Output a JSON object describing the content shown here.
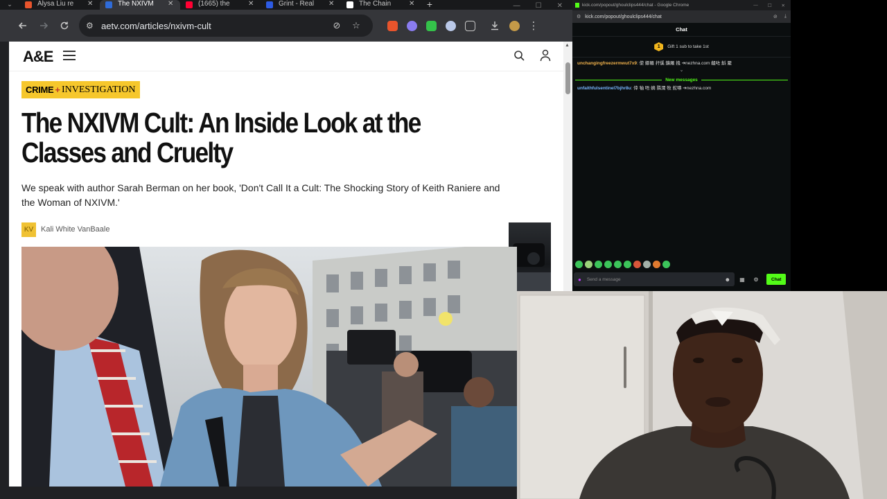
{
  "browser": {
    "tabs": [
      {
        "title": "Alysa Liu re",
        "favicon_color": "#e8542c",
        "active": false
      },
      {
        "title": "The NXIVM",
        "favicon_color": "#2f6bd8",
        "active": true
      },
      {
        "title": "(1665) the",
        "favicon_color": "#ff0033",
        "active": false
      },
      {
        "title": "Grint - Real",
        "favicon_color": "#2d5be3",
        "active": false
      },
      {
        "title": "The Chain",
        "favicon_color": "#ffffff",
        "active": false
      }
    ],
    "url": "aetv.com/articles/nxivm-cult"
  },
  "site": {
    "logo": "A&E"
  },
  "article": {
    "category_left": "CRIME",
    "category_plus": "+",
    "category_right": "INVESTIGATION",
    "headline": "The NXIVM Cult: An Inside Look at the Classes and Cruelty",
    "dek": "We speak with author Sarah Berman on her book, 'Don't Call It a Cult: The Shocking Story of Keith Raniere and the Woman of NXIVM.'",
    "author_initials": "KV",
    "author": "Kali White VanBaale"
  },
  "chat_window": {
    "title": "kick.com/popout/ghoulclips444/chat - Google Chrome",
    "url": "kick.com/popout/ghoulclips444/chat",
    "header": "Chat",
    "gift_count": "1",
    "gift_text": "Gift 1 sub to take 1st",
    "messages": [
      {
        "user": "unchangingfreezermwut7x9",
        "user_color": "#f2b34c",
        "text": ": 使 娜羅 扞傒 鑛羅 拽 ➔nezhna.com 齟咗 斛 龎"
      },
      {
        "user": "unfaithfulsentinel7bjhr8u",
        "user_color": "#78b7ff",
        "text": ": 倖 牰 唔 嫡 隣澗 牧 舵嚊 ➔nezhna.com"
      }
    ],
    "new_messages_label": "New messages",
    "input_placeholder": "Send a message",
    "send_label": "Chat"
  }
}
